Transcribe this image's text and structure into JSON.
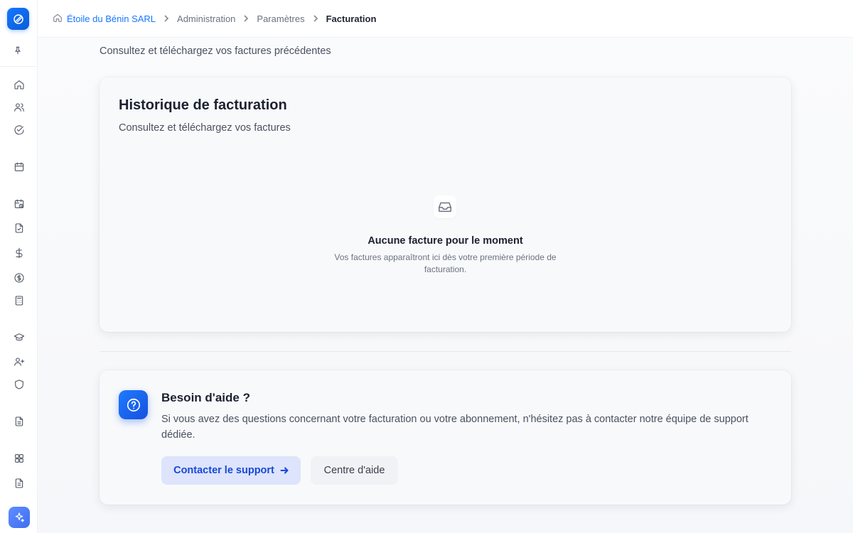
{
  "breadcrumb": {
    "items": [
      "Étoile du Bénin SARL",
      "Administration",
      "Paramètres",
      "Facturation"
    ]
  },
  "page": {
    "subtitle": "Consultez et téléchargez vos factures précédentes"
  },
  "history_card": {
    "title": "Historique de facturation",
    "subtitle": "Consultez et téléchargez vos factures",
    "empty_title": "Aucune facture pour le moment",
    "empty_text": "Vos factures apparaîtront ici dès votre première période de facturation."
  },
  "help_card": {
    "title": "Besoin d'aide ?",
    "text": "Si vous avez des questions concernant votre facturation ou votre abonnement, n'hésitez pas à contacter notre équipe de support dédiée.",
    "primary_button": "Contacter le support",
    "secondary_button": "Centre d'aide"
  },
  "sidebar": {
    "icons": [
      "home-icon",
      "users-icon",
      "check-circle-icon",
      "calendar-icon",
      "calendar-clock-icon",
      "file-check-icon",
      "dollar-icon",
      "coin-icon",
      "calculator-icon",
      "graduation-cap-icon",
      "user-plus-icon",
      "shield-icon",
      "document-icon",
      "grid-icon",
      "file-text-icon"
    ]
  },
  "colors": {
    "accent": "#1677ff",
    "primary_button_bg": "#dde4fb",
    "primary_button_text": "#1848d6"
  }
}
